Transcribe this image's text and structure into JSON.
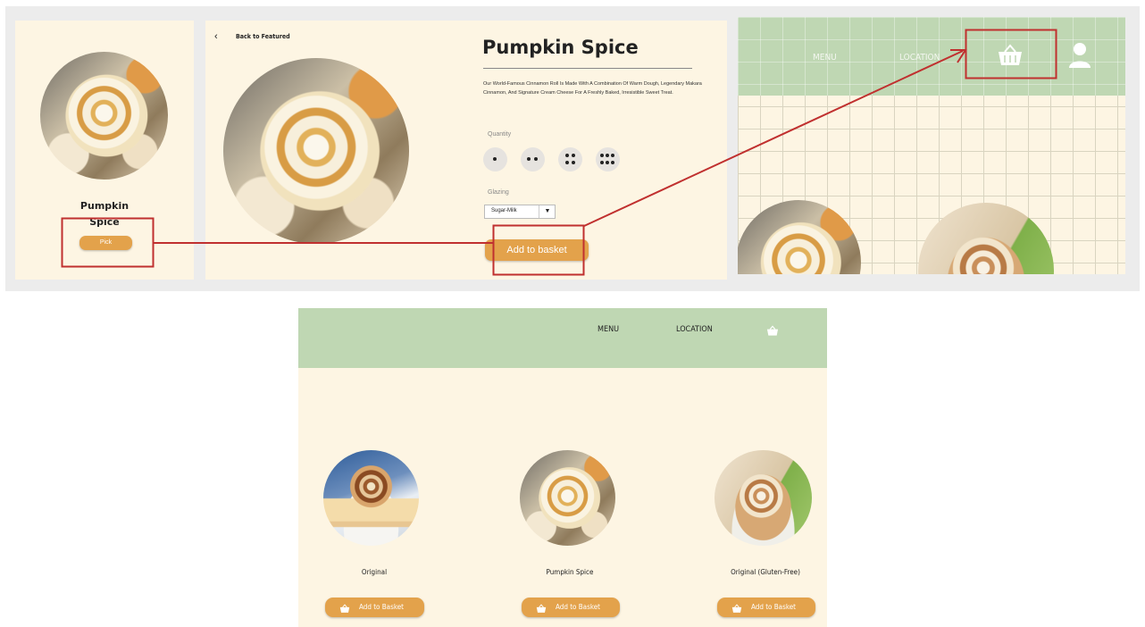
{
  "panel1": {
    "title_line1": "Pumpkin",
    "title_line2": "Spice",
    "pick_label": "Pick"
  },
  "panel2": {
    "back_label": "Back to Featured",
    "title": "Pumpkin Spice",
    "description": "Our World-Famous Cinnamon Roll Is Made With A Combination Of Warm Dough, Legendary Makara Cinnamon, And Signature Cream Cheese For A Freshly Baked, Irresistible Sweet Treat.",
    "quantity_label": "Quantity",
    "quantity_options": [
      1,
      2,
      4,
      6
    ],
    "glazing_label": "Glazing",
    "glazing_value": "Sugar-Milk",
    "add_to_basket": "Add to basket"
  },
  "panel3": {
    "nav": {
      "menu": "MENU",
      "location": "LOCATION"
    }
  },
  "menu_page": {
    "nav": {
      "menu": "MENU",
      "location": "LOCATION"
    },
    "products": [
      {
        "name": "Original",
        "button": "Add to Basket",
        "image": "original-roll"
      },
      {
        "name": "Pumpkin Spice",
        "button": "Add to Basket",
        "image": "pumpkin-spice-roll"
      },
      {
        "name": "Original (Gluten-Free)",
        "button": "Add to Basket",
        "image": "gluten-free-roll"
      }
    ]
  },
  "colors": {
    "accent": "#e3a24b",
    "header_green": "#bfd7b3",
    "background_cream": "#fdf5e3",
    "annotation_red": "#c0302f"
  },
  "icons": [
    "chevron-left-icon",
    "basket-icon",
    "user-icon",
    "dropdown-arrow-icon"
  ]
}
